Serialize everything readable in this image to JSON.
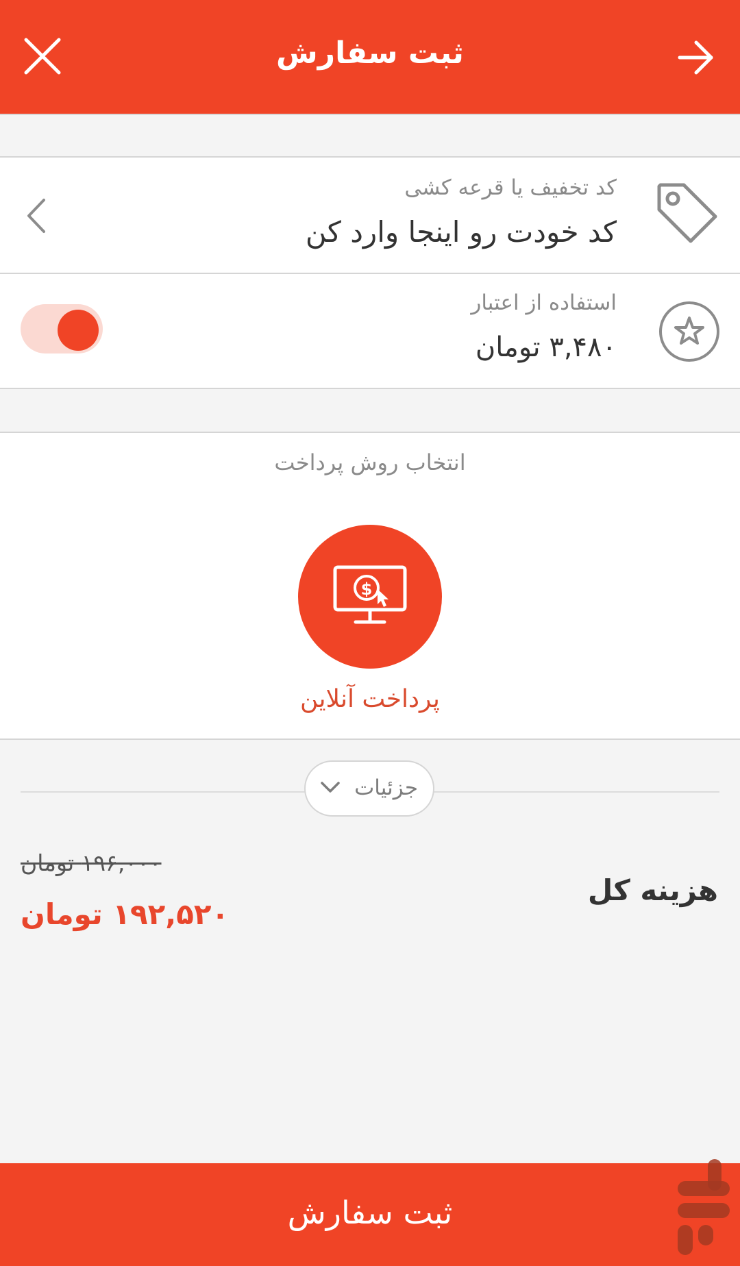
{
  "header": {
    "title": "ثبت سفارش",
    "close_icon": "close-icon",
    "back_icon": "arrow-right-icon"
  },
  "discount": {
    "label": "کد تخفیف یا قرعه کشی",
    "placeholder": "کد خودت رو اینجا وارد کن",
    "icon": "tag-icon",
    "chevron_icon": "chevron-left-icon"
  },
  "credit": {
    "label": "استفاده از اعتبار",
    "amount": "۳,۴۸۰ تومان",
    "icon": "star-icon",
    "toggle_on": true
  },
  "payment": {
    "heading": "انتخاب روش پرداخت",
    "method_label": "پرداخت آنلاین",
    "method_icon": "monitor-dollar-icon"
  },
  "details": {
    "label": "جزئیات",
    "chevron_icon": "chevron-down-icon"
  },
  "total": {
    "label": "هزینه کل",
    "old_price": "۱۹۶,۰۰۰ تومان",
    "new_price": "۱۹۲,۵۲۰ تومان"
  },
  "submit": {
    "label": "ثبت سفارش"
  },
  "colors": {
    "accent": "#f04426",
    "accent_light": "#fbd9d2",
    "price_red": "#e8462c"
  }
}
